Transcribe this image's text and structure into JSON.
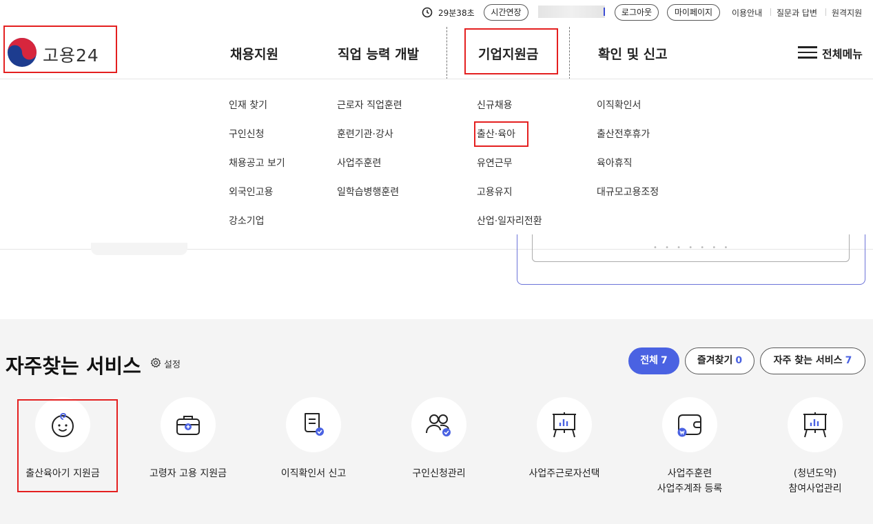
{
  "util_bar": {
    "timer": "29분38초",
    "extend_label": "시간연장",
    "logout_label": "로그아웃",
    "mypage_label": "마이페이지",
    "links": [
      "이용안내",
      "질문과 답변",
      "원격지원"
    ]
  },
  "logo": {
    "text": "고용24"
  },
  "gnb": {
    "items": [
      "채용지원",
      "직업 능력 개발",
      "기업지원금",
      "확인 및 신고"
    ],
    "all_menu_label": "전체메뉴"
  },
  "mega_menu": {
    "col1": [
      "인재 찾기",
      "구인신청",
      "채용공고 보기",
      "외국인고용",
      "강소기업"
    ],
    "col2": [
      "근로자 직업훈련",
      "훈련기관·강사",
      "사업주훈련",
      "일학습병행훈련"
    ],
    "col3": [
      "신규채용",
      "출산·육아",
      "유연근무",
      "고용유지",
      "산업·일자리전환"
    ],
    "col4": [
      "이직확인서",
      "출산전후휴가",
      "육아휴직",
      "대규모고용조정"
    ]
  },
  "services": {
    "title": "자주찾는 서비스",
    "setting_label": "설정",
    "tabs": [
      {
        "label": "전체",
        "count": "7"
      },
      {
        "label": "즐겨찾기",
        "count": "0"
      },
      {
        "label": "자주 찾는 서비스",
        "count": "7"
      }
    ],
    "items": [
      {
        "label": "출산육아기 지원금",
        "icon": "baby-face-icon"
      },
      {
        "label": "고령자 고용 지원금",
        "icon": "briefcase-icon"
      },
      {
        "label": "이직확인서 신고",
        "icon": "document-check-icon"
      },
      {
        "label": "구인신청관리",
        "icon": "people-check-icon"
      },
      {
        "label": "사업주근로자선택",
        "icon": "presentation-board-icon"
      },
      {
        "label": "사업주훈련\n사업주계좌 등록",
        "icon": "wallet-icon"
      },
      {
        "label": "(청년도약)\n참여사업관리",
        "icon": "presentation-board-icon"
      }
    ]
  },
  "colors": {
    "accent": "#4a62e2",
    "highlight": "#e41f1f",
    "section_bg": "#f4f4f4"
  }
}
